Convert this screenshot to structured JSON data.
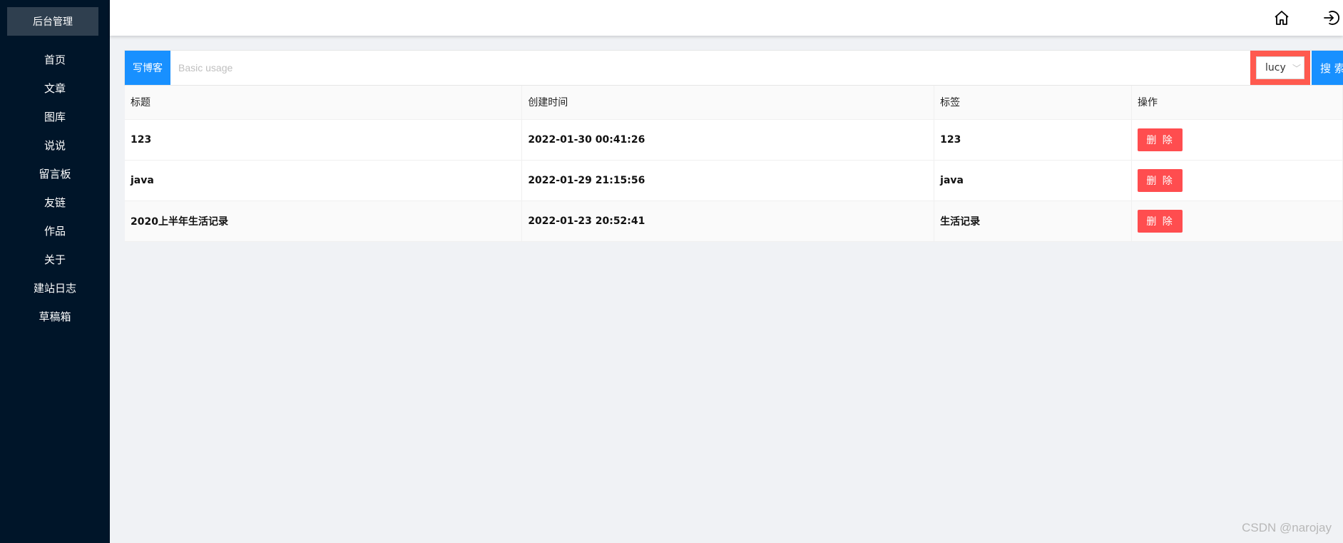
{
  "sidebar": {
    "brand": "后台管理",
    "items": [
      {
        "label": "首页"
      },
      {
        "label": "文章"
      },
      {
        "label": "图库"
      },
      {
        "label": "说说"
      },
      {
        "label": "留言板"
      },
      {
        "label": "友链"
      },
      {
        "label": "作品"
      },
      {
        "label": "关于"
      },
      {
        "label": "建站日志"
      },
      {
        "label": "草稿箱"
      }
    ]
  },
  "header": {
    "icons": [
      "home-icon",
      "logout-icon"
    ]
  },
  "toolbar": {
    "write_label": "写博客",
    "search_placeholder": "Basic usage",
    "select_value": "lucy",
    "search_label": "搜 索"
  },
  "table": {
    "headers": [
      "标题",
      "创建时间",
      "标签",
      "操作"
    ],
    "rows": [
      {
        "title": "123",
        "created": "2022-01-30 00:41:26",
        "tag": "123",
        "action": "删 除"
      },
      {
        "title": "java",
        "created": "2022-01-29 21:15:56",
        "tag": "java",
        "action": "删 除"
      },
      {
        "title": "2020上半年生活记录",
        "created": "2022-01-23 20:52:41",
        "tag": "生活记录",
        "action": "删 除"
      }
    ]
  },
  "watermark": "CSDN @narojay",
  "colors": {
    "sidebar_bg": "#001529",
    "primary": "#1890ff",
    "danger": "#ff4d4f",
    "select_bg": "#ff5a4f"
  }
}
